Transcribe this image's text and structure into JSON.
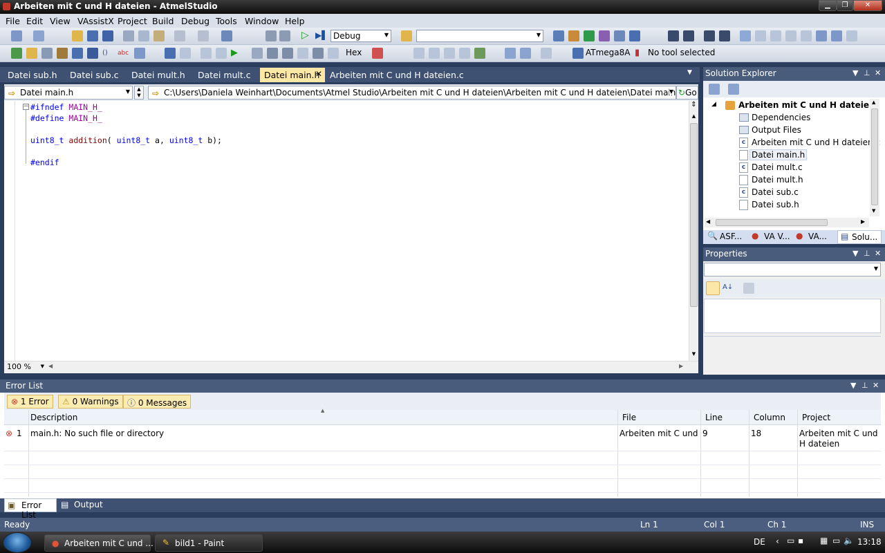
{
  "window": {
    "title": "Arbeiten mit C und H dateien - AtmelStudio"
  },
  "menu": [
    "File",
    "Edit",
    "View",
    "VAssistX",
    "Project",
    "Build",
    "Debug",
    "Tools",
    "Window",
    "Help"
  ],
  "toolbar": {
    "config": "Debug",
    "hex_label": "Hex",
    "device": "ATmega8A",
    "tool": "No tool selected"
  },
  "tabs": [
    "Datei sub.h",
    "Datei sub.c",
    "Datei mult.h",
    "Datei mult.c",
    "Datei main.h",
    "Arbeiten mit C und H dateien.c"
  ],
  "nav": {
    "file": "Datei main.h",
    "path": "C:\\Users\\Daniela Weinhart\\Documents\\Atmel Studio\\Arbeiten mit C und H dateien\\Arbeiten mit C und H dateien\\Datei main.h",
    "go": "Go"
  },
  "code": {
    "l1a": "#ifndef",
    "l1b": " MAIN_H_",
    "l2a": "#define",
    "l2b": " MAIN_H_",
    "l4a": "uint8_t",
    "l4b": " addition",
    "l4c": "( ",
    "l4d": "uint8_t",
    "l4e": " a, ",
    "l4f": "uint8_t",
    "l4g": " b);",
    "l6": "#endif"
  },
  "zoom": "100 %",
  "solution_explorer": {
    "title": "Solution Explorer",
    "project": "Arbeiten mit C und H dateien",
    "items": [
      "Dependencies",
      "Output Files",
      "Arbeiten mit C und H dateien.c",
      "Datei main.h",
      "Datei mult.c",
      "Datei mult.h",
      "Datei sub.c",
      "Datei sub.h"
    ],
    "tabs": [
      "ASF...",
      "VA V...",
      "VA...",
      "Solu..."
    ]
  },
  "properties": {
    "title": "Properties"
  },
  "error_list": {
    "title": "Error List",
    "filters": [
      "1 Error",
      "0 Warnings",
      "0 Messages"
    ],
    "columns": [
      "Description",
      "File",
      "Line",
      "Column",
      "Project"
    ],
    "rows": [
      {
        "num": "1",
        "desc": "main.h: No such file or directory",
        "file": "Arbeiten mit C und H",
        "line": "9",
        "col": "18",
        "project": "Arbeiten mit C und H dateien"
      }
    ]
  },
  "bottom_tabs": [
    "Error List",
    "Output"
  ],
  "status": {
    "text": "Ready",
    "ln": "Ln 1",
    "col": "Col 1",
    "ch": "Ch 1",
    "mode": "INS"
  },
  "taskbar": {
    "tasks": [
      "Arbeiten mit C und ...",
      "bild1 - Paint"
    ],
    "lang": "DE",
    "clock": "13:18"
  }
}
